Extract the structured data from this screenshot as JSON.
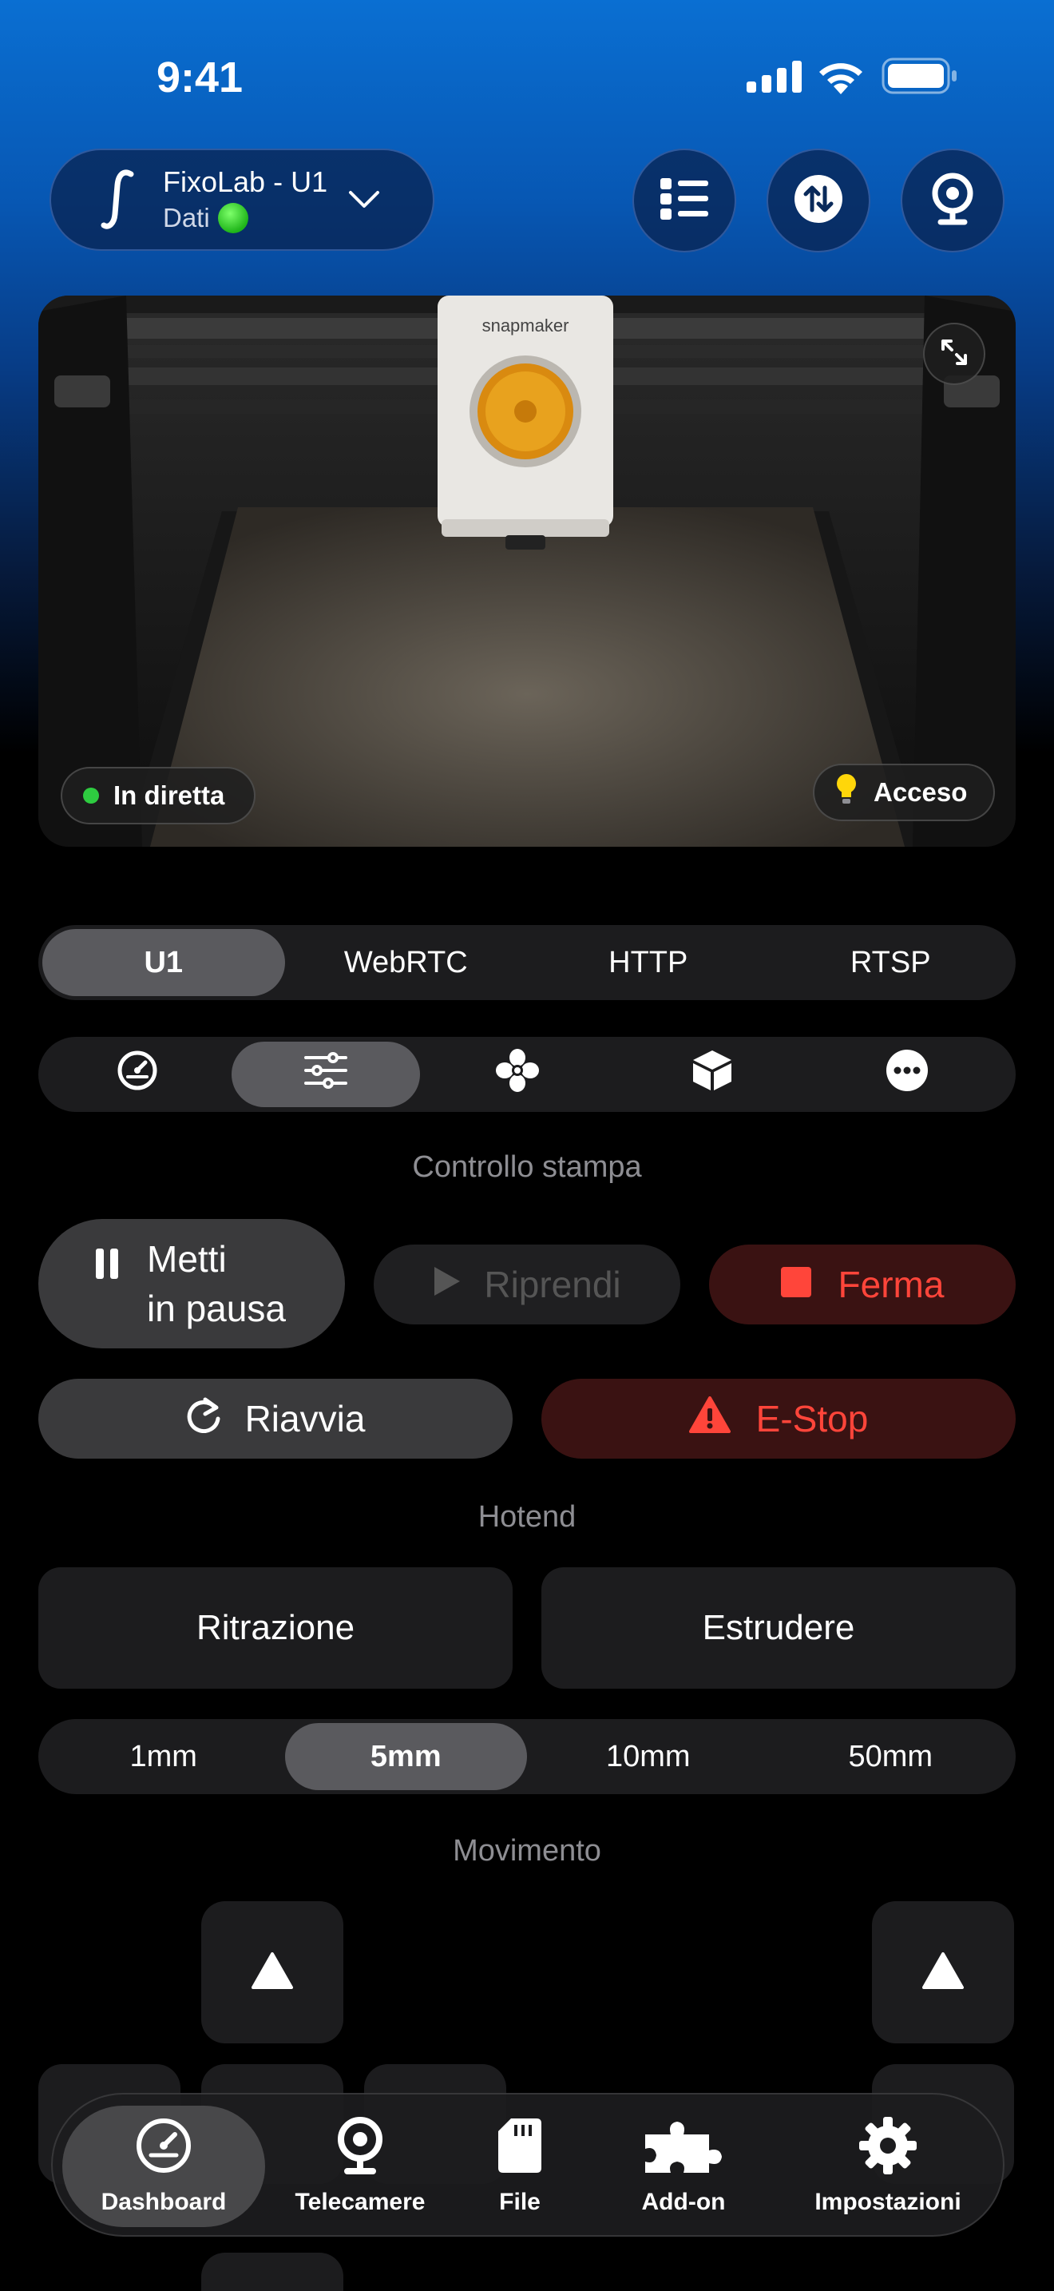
{
  "status_bar": {
    "time": "9:41"
  },
  "printer": {
    "name": "FixoLab - U1",
    "status": "Dati",
    "status_color": "#2ecc40"
  },
  "header_actions": [
    "list-icon",
    "transfer-icon",
    "webcam-icon"
  ],
  "camera": {
    "live_label": "In diretta",
    "light_label": "Acceso",
    "brand_text": "snapmaker"
  },
  "stream_sources": {
    "options": [
      "U1",
      "WebRTC",
      "HTTP",
      "RTSP"
    ],
    "selected": "U1"
  },
  "control_tabs": {
    "icons": [
      "gauge-icon",
      "sliders-icon",
      "fan-icon",
      "box-icon",
      "more-icon"
    ],
    "selected": "sliders-icon"
  },
  "print_control": {
    "section_label": "Controllo stampa",
    "pause_line1": "Metti",
    "pause_line2": "in pausa",
    "resume": "Riprendi",
    "stop": "Ferma",
    "restart": "Riavvia",
    "estop": "E-Stop"
  },
  "hotend": {
    "section_label": "Hotend",
    "retract": "Ritrazione",
    "extrude": "Estrudere",
    "distances": [
      "1mm",
      "5mm",
      "10mm",
      "50mm"
    ],
    "selected_distance": "5mm"
  },
  "movement": {
    "section_label": "Movimento"
  },
  "tab_bar": {
    "items": [
      {
        "label": "Dashboard",
        "icon": "gauge-icon",
        "selected": true
      },
      {
        "label": "Telecamere",
        "icon": "webcam-icon",
        "selected": false
      },
      {
        "label": "File",
        "icon": "sd-card-icon",
        "selected": false
      },
      {
        "label": "Add-on",
        "icon": "puzzle-icon",
        "selected": false
      },
      {
        "label": "Impostazioni",
        "icon": "gear-icon",
        "selected": false
      }
    ]
  },
  "colors": {
    "accent_blue": "#0a6fd2",
    "danger": "#ff453a",
    "danger_bg": "#3a1212"
  }
}
